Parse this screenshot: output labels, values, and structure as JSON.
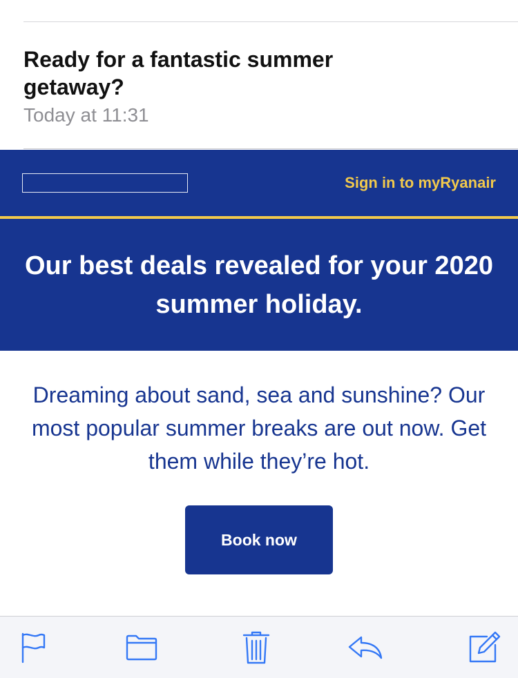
{
  "email": {
    "subject": "Ready for a fantastic summer getaway?",
    "date": "Today at 11:31"
  },
  "brand_bar": {
    "signin_label": "Sign in to myRyanair"
  },
  "hero": {
    "title": "Our best deals revealed for your 2020 summer holiday."
  },
  "content": {
    "body": "Dreaming about sand, sea and sunshine? Our most popular summer breaks are out now. Get them while they’re hot.",
    "cta_label": "Book now"
  },
  "toolbar": {
    "icons": [
      "flag-icon",
      "folder-icon",
      "trash-icon",
      "reply-icon",
      "compose-icon"
    ]
  },
  "colors": {
    "brand_blue": "#173590",
    "brand_gold": "#f2c94c",
    "ios_blue": "#3478f6"
  }
}
